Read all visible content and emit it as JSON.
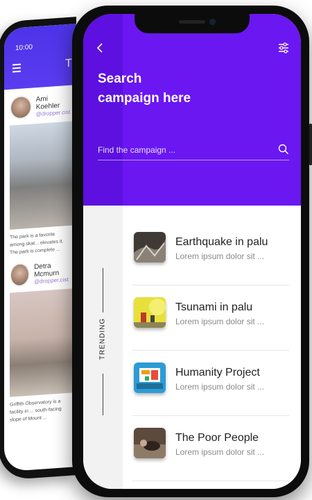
{
  "back_phone": {
    "status_time": "10:00",
    "title": "Tr",
    "posts": [
      {
        "name": "Ami Koehler",
        "handle": "@dropper.cist",
        "text": "The park is a favorite among skat... elevates it. The park is complete ..."
      },
      {
        "name": "Detra Mcmurn",
        "handle": "@dropper.cist",
        "text": "Griffith Observatory is a facility in ... south-facing slope of Mount ..."
      }
    ]
  },
  "header": {
    "title": "Search\ncampaign here",
    "back_icon": "chevron-left-icon",
    "filter_icon": "sliders-icon"
  },
  "search": {
    "placeholder": "Find the campaign ...",
    "value": "",
    "icon": "search-icon"
  },
  "sidebar": {
    "label": "TRENDING"
  },
  "campaigns": [
    {
      "title": "Earthquake in palu",
      "subtitle": "Lorem ipsum dolor sit ..."
    },
    {
      "title": "Tsunami in palu",
      "subtitle": "Lorem ipsum dolor sit ..."
    },
    {
      "title": "Humanity Project",
      "subtitle": "Lorem ipsum dolor sit ..."
    },
    {
      "title": "The Poor People",
      "subtitle": "Lorem ipsum dolor sit ..."
    }
  ],
  "colors": {
    "primary": "#6a17f2",
    "primary_dark": "#5d10e0",
    "sidebar": "#f2f2f2"
  }
}
